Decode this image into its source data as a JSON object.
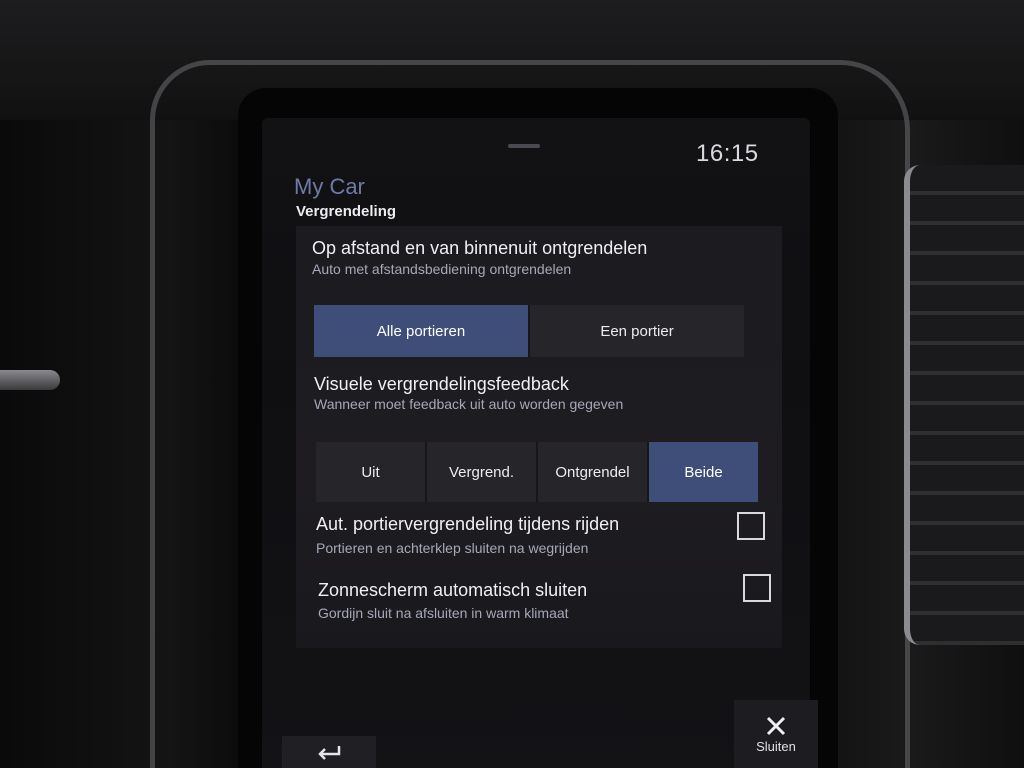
{
  "status": {
    "time": "16:15"
  },
  "header": {
    "app_title": "My Car",
    "section_title": "Vergrendeling"
  },
  "settings": {
    "remote_unlock": {
      "title": "Op afstand en van binnenuit ontgrendelen",
      "subtitle": "Auto met afstandsbediening ontgrendelen",
      "options": [
        "Alle portieren",
        "Een portier"
      ],
      "selected": "Alle portieren"
    },
    "visual_feedback": {
      "title": "Visuele vergrendelingsfeedback",
      "subtitle": "Wanneer moet feedback uit auto worden gegeven",
      "options": [
        "Uit",
        "Vergrend.",
        "Ontgrendel",
        "Beide"
      ],
      "selected": "Beide"
    },
    "auto_lock": {
      "title": "Aut. portiervergrendeling tijdens rijden",
      "subtitle": "Portieren en achterklep sluiten na wegrijden",
      "checked": false
    },
    "sunshade": {
      "title": "Zonnescherm automatisch sluiten",
      "subtitle": "Gordijn sluit na afsluiten in warm klimaat",
      "checked": false
    }
  },
  "footer": {
    "close_label": "Sluiten",
    "back_icon": "back-arrow-icon",
    "close_icon": "close-x-icon"
  },
  "colors": {
    "accent": "#3f4e78",
    "title_accent": "#6f7aa6",
    "panel": "#1b1b20"
  }
}
